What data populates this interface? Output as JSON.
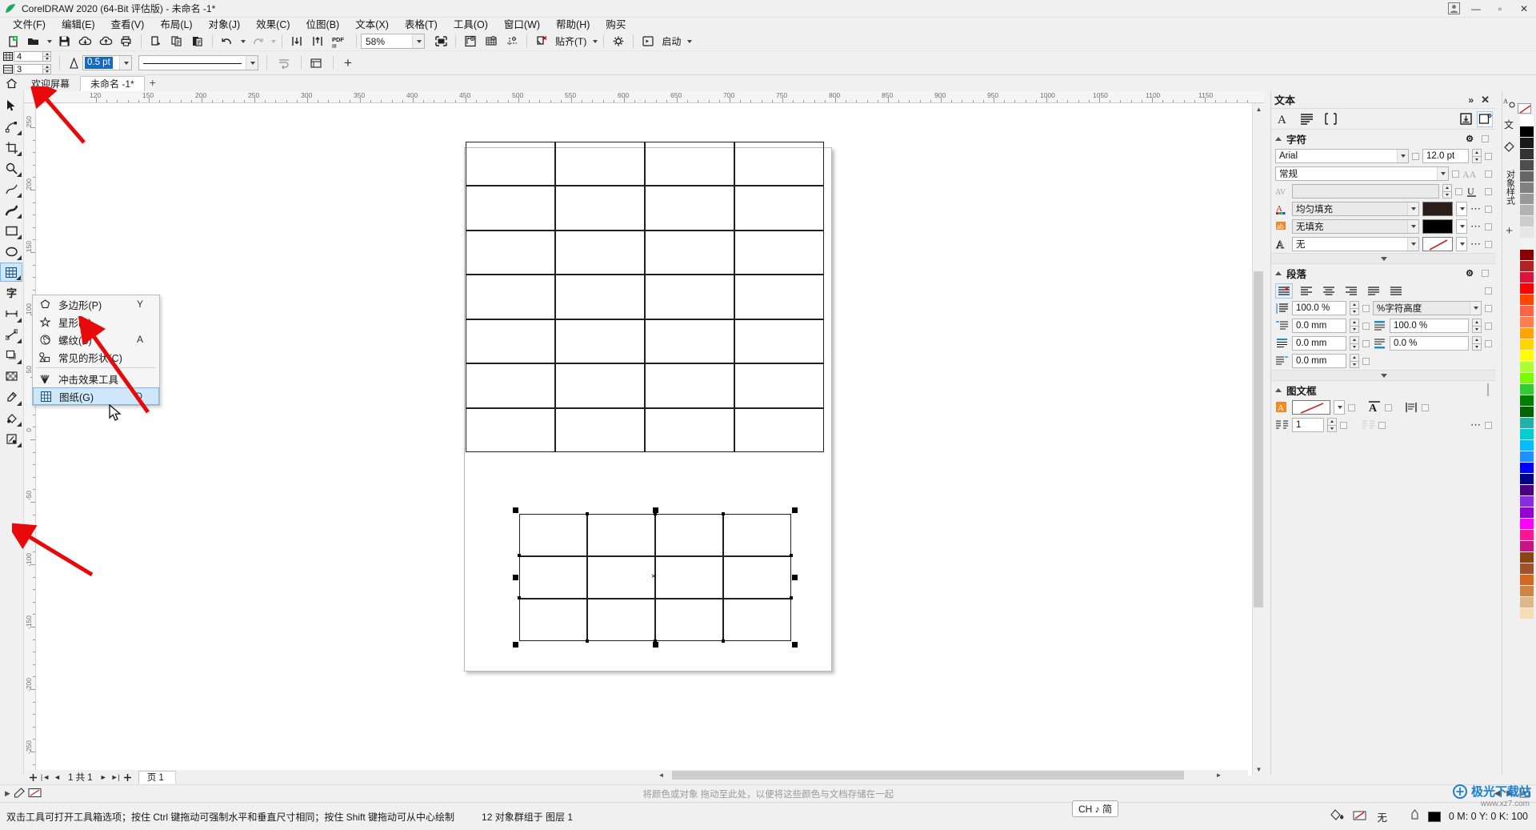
{
  "window": {
    "title": "CorelDRAW 2020 (64-Bit 评估版) - 未命名 -1*",
    "logo_icon": "coreldraw-logo-icon",
    "user_icon": "user-account-icon",
    "minimize": "—",
    "maximize": "▫",
    "close": "✕"
  },
  "menubar": {
    "items": [
      {
        "label": "文件(F)",
        "name": "menu-file"
      },
      {
        "label": "编辑(E)",
        "name": "menu-edit"
      },
      {
        "label": "查看(V)",
        "name": "menu-view"
      },
      {
        "label": "布局(L)",
        "name": "menu-layout"
      },
      {
        "label": "对象(J)",
        "name": "menu-object"
      },
      {
        "label": "效果(C)",
        "name": "menu-effects"
      },
      {
        "label": "位图(B)",
        "name": "menu-bitmap"
      },
      {
        "label": "文本(X)",
        "name": "menu-text"
      },
      {
        "label": "表格(T)",
        "name": "menu-table"
      },
      {
        "label": "工具(O)",
        "name": "menu-tools"
      },
      {
        "label": "窗口(W)",
        "name": "menu-window"
      },
      {
        "label": "帮助(H)",
        "name": "menu-help"
      },
      {
        "label": "购买",
        "name": "menu-buy"
      }
    ]
  },
  "toolbar": {
    "zoom_level": "58%",
    "snap_label": "贴齐(T)",
    "launch_label": "启动",
    "icons": [
      "new-document-icon",
      "open-document-icon",
      "save-icon",
      "cloud-download-icon",
      "cloud-upload-icon",
      "print-icon",
      "cut-icon",
      "copy-icon",
      "paste-icon",
      "undo-icon",
      "redo-icon",
      "import-icon",
      "export-icon",
      "export-pdf-icon",
      "fullscreen-preview-icon",
      "show-rulers-icon",
      "show-grid-icon",
      "show-guides-icon",
      "snap-off-icon",
      "options-gear-icon",
      "launch-icon"
    ]
  },
  "propertybar": {
    "columns_value": "4",
    "rows_value": "3",
    "outline_width": "0.5 pt",
    "line_style_label": "",
    "columns_icon": "graph-columns-icon",
    "rows_icon": "graph-rows-icon",
    "outline_icon": "outline-width-icon",
    "line_style_icon": "line-style-icon",
    "wrap_text_icon": "wrap-text-icon",
    "edit_icon": "edit-icon",
    "add_icon": "add-icon"
  },
  "doctabs": {
    "home_icon": "home-icon",
    "tabs": [
      {
        "label": "欢迎屏幕",
        "active": false,
        "name": "tab-welcome-screen"
      },
      {
        "label": "未命名 -1*",
        "active": true,
        "name": "tab-untitled-1"
      }
    ],
    "add_label": "+"
  },
  "toolbox": {
    "tools": [
      {
        "name": "pick-tool",
        "icon": "arrow-cursor-icon",
        "flyout": false
      },
      {
        "name": "shape-tool",
        "icon": "node-edit-icon",
        "flyout": true
      },
      {
        "name": "crop-tool",
        "icon": "crop-icon",
        "flyout": true
      },
      {
        "name": "zoom-tool",
        "icon": "magnifier-icon",
        "flyout": true
      },
      {
        "name": "freehand-tool",
        "icon": "freehand-curve-icon",
        "flyout": true
      },
      {
        "name": "artistic-media-tool",
        "icon": "artistic-media-icon",
        "flyout": true
      },
      {
        "name": "rectangle-tool",
        "icon": "rectangle-icon",
        "flyout": true
      },
      {
        "name": "ellipse-tool",
        "icon": "ellipse-icon",
        "flyout": true
      },
      {
        "name": "polygon-tool",
        "icon": "graph-paper-icon",
        "flyout": true,
        "active": true
      },
      {
        "name": "text-tool",
        "icon": "text-tool-icon",
        "flyout": false
      },
      {
        "name": "parallel-dimension-tool",
        "icon": "dimension-icon",
        "flyout": true
      },
      {
        "name": "straight-line-connector-tool",
        "icon": "connector-icon",
        "flyout": true
      },
      {
        "name": "drop-shadow-tool",
        "icon": "drop-shadow-icon",
        "flyout": true
      },
      {
        "name": "transparency-tool",
        "icon": "transparency-icon",
        "flyout": false
      },
      {
        "name": "color-eyedropper-tool",
        "icon": "eyedropper-icon",
        "flyout": true
      },
      {
        "name": "interactive-fill-tool",
        "icon": "fill-icon",
        "flyout": true
      },
      {
        "name": "smart-fill-tool",
        "icon": "smart-fill-icon",
        "flyout": true
      }
    ]
  },
  "flyout_menu": {
    "items": [
      {
        "label": "多边形(P)",
        "shortcut": "Y",
        "icon": "polygon-icon",
        "selected": false,
        "name": "flyout-polygon"
      },
      {
        "label": "星形(S)",
        "shortcut": "",
        "icon": "star-icon",
        "selected": false,
        "name": "flyout-star"
      },
      {
        "label": "螺纹(S)",
        "shortcut": "A",
        "icon": "spiral-icon",
        "selected": false,
        "name": "flyout-spiral"
      },
      {
        "label": "常见的形状(C)",
        "shortcut": "",
        "icon": "common-shapes-icon",
        "selected": false,
        "name": "flyout-common-shapes"
      },
      {
        "label": "冲击效果工具",
        "shortcut": "",
        "icon": "impact-effect-icon",
        "selected": false,
        "name": "flyout-impact-tool"
      },
      {
        "label": "图纸(G)",
        "shortcut": "D",
        "icon": "graph-paper-icon",
        "selected": true,
        "name": "flyout-graph-paper"
      }
    ]
  },
  "rulers": {
    "horizontal_labels": [
      "120",
      "150",
      "200",
      "250",
      "300",
      "350",
      "400",
      "450",
      "500",
      "550",
      "600",
      "650",
      "700",
      "750",
      "800",
      "850",
      "900",
      "950",
      "1000",
      "1050",
      "1100",
      "1150"
    ],
    "horizontal_visible": [
      "120",
      "150",
      "200",
      "250",
      "300",
      "350",
      "400"
    ],
    "vertical_labels": [
      "250",
      "200",
      "150",
      "100",
      "50",
      "0",
      "-50",
      "-100",
      "-150",
      "-200",
      "-250"
    ]
  },
  "canvas": {
    "top_grid": {
      "rows": 7,
      "cols": 4,
      "name": "graph-paper-object-top"
    },
    "selected_grid": {
      "rows": 3,
      "cols": 4,
      "name": "graph-paper-object-selected"
    },
    "center_marker": "×"
  },
  "docker": {
    "title": "文本",
    "collapse_icon": "collapse-docker-icon",
    "close_icon": "close-docker-icon",
    "tabs": [
      {
        "icon": "character-A-icon",
        "name": "docker-tab-character",
        "selected": false
      },
      {
        "icon": "paragraph-lines-icon",
        "name": "docker-tab-paragraph",
        "selected": false
      },
      {
        "icon": "frame-icon",
        "name": "docker-tab-frame",
        "selected": false
      }
    ],
    "right_icons": [
      {
        "icon": "import-text-icon",
        "name": "import-text-button"
      },
      {
        "icon": "text-frame-button-icon",
        "name": "text-frame-button",
        "selected": true
      }
    ],
    "character": {
      "heading": "字符",
      "font_family": "Arial",
      "font_size": "12.0 pt",
      "font_style": "常规",
      "kerning_placeholder": "",
      "fill_type": "均匀填充",
      "fill_color": "#2b1d1a",
      "outline_type": "无填充",
      "outline_color": "#000000",
      "background_type": "无",
      "background_color": "none",
      "icons": [
        "kerning-icon",
        "fill-A-icon",
        "background-ab-icon",
        "outline-A-icon",
        "caps-icon",
        "underline-icon",
        "gear-icon"
      ]
    },
    "paragraph": {
      "heading": "段落",
      "align_buttons": [
        "no-align-icon",
        "align-left-icon",
        "align-center-icon",
        "align-right-icon",
        "align-justify-icon",
        "align-force-justify-icon"
      ],
      "selected_align": 0,
      "line_spacing": "100.0 %",
      "line_spacing_unit": "%字符高度",
      "left_indent": "0.0 mm",
      "before_paragraph": "100.0 %",
      "first_line_indent": "0.0 mm",
      "after_paragraph": "0.0 %",
      "right_indent": "0.0 mm"
    },
    "frame": {
      "heading": "图文框",
      "frame_color": "none",
      "columns": "1",
      "icons": [
        "frame-fill-icon",
        "frame-text-icon",
        "vertical-align-icon",
        "columns-icon",
        "frame-settings-icon"
      ]
    },
    "side_tabs": [
      {
        "label": "对象样式",
        "name": "side-tab-object-styles",
        "icon": "object-styles-icon"
      },
      {
        "label": "",
        "name": "side-tab-add",
        "icon": "plus-icon"
      }
    ]
  },
  "pagenav": {
    "first_icon": "first-page-icon",
    "prev_icon": "prev-page-icon",
    "page_info": "1 共 1",
    "next_icon": "next-page-icon",
    "last_icon": "last-page-icon",
    "add_page_icon": "add-page-icon",
    "page_tab": "页 1"
  },
  "statusbar": {
    "hint": "双击工具可打开工具箱选项；按住 Ctrl 键拖动可强制水平和垂直尺寸相同；按住 Shift 键拖动可从中心绘制",
    "object_info": "12 对象群组于 图层 1",
    "drag_hint": "将颜色或对象 拖动至此处，以便将这些颜色与文档存储在一起",
    "ime": "CH ♪ 简",
    "fill_label": "无",
    "outline_label": "无",
    "coords": "0 M:  0 Y:  0 K:  100",
    "fill_swatch": "#000000",
    "outline_color": "#cc0000"
  },
  "watermark": {
    "text": "极光下载站",
    "sub": "www.xz7.com"
  },
  "palette": {
    "colors": [
      "#ffffff",
      "#000000",
      "#1a1a1a",
      "#333333",
      "#4d4d4d",
      "#666666",
      "#808080",
      "#999999",
      "#b3b3b3",
      "#cccccc",
      "#e6e6e6",
      "#f2f2f2",
      "#8b0000",
      "#b22222",
      "#dc143c",
      "#ff0000",
      "#ff4500",
      "#ff6347",
      "#ff7f50",
      "#ffa500",
      "#ffd700",
      "#ffff00",
      "#adff2f",
      "#7cfc00",
      "#32cd32",
      "#008000",
      "#006400",
      "#20b2aa",
      "#00ced1",
      "#00bfff",
      "#1e90ff",
      "#0000ff",
      "#00008b",
      "#4b0082",
      "#8a2be2",
      "#9400d3",
      "#ff00ff",
      "#ff1493",
      "#c71585",
      "#8b4513",
      "#a0522d",
      "#d2691e",
      "#cd853f",
      "#deb887",
      "#f5deb3"
    ]
  }
}
